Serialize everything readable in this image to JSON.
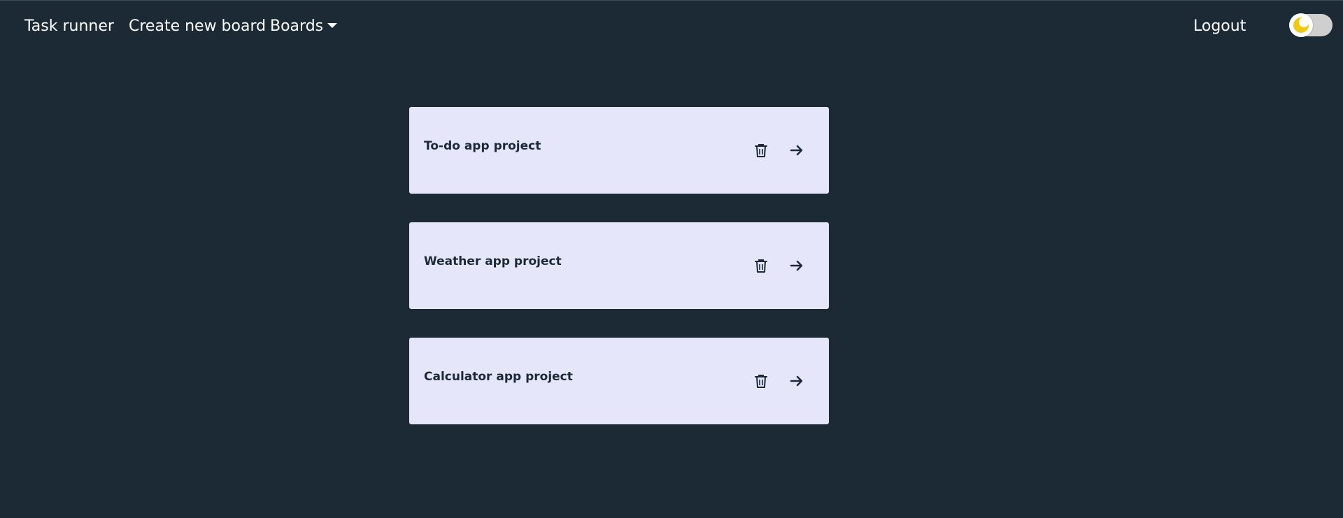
{
  "navbar": {
    "brand": "Task runner",
    "create_board": "Create new board",
    "boards_menu": "Boards",
    "logout": "Logout",
    "theme_toggle_icon": "moon-icon"
  },
  "boards": [
    {
      "title": "To-do app project",
      "delete_icon": "trash-icon",
      "open_icon": "arrow-right-icon"
    },
    {
      "title": "Weather app project",
      "delete_icon": "trash-icon",
      "open_icon": "arrow-right-icon"
    },
    {
      "title": "Calculator app project",
      "delete_icon": "trash-icon",
      "open_icon": "arrow-right-icon"
    }
  ],
  "colors": {
    "background": "#1b2a35",
    "card": "#e6e6fa",
    "card_text": "#1b2a35",
    "nav_text": "#ffffff",
    "toggle_icon": "#f2c811"
  }
}
